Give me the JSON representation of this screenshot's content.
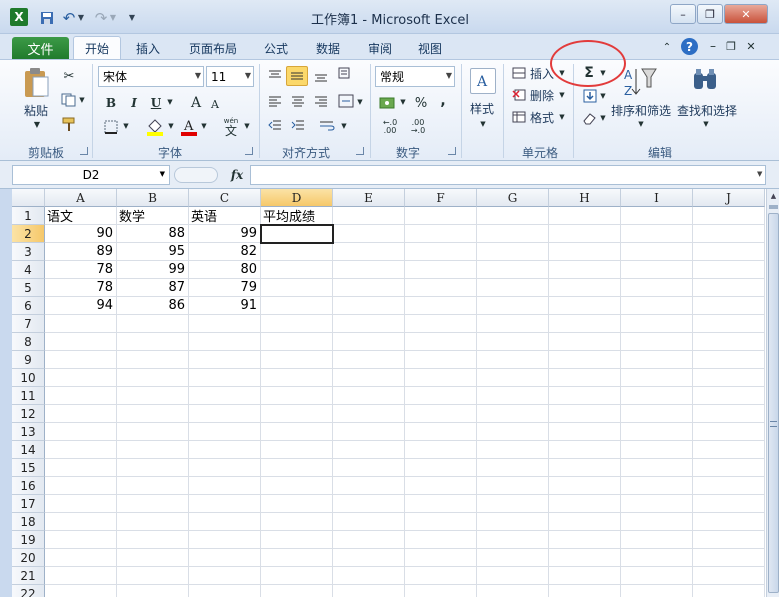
{
  "window": {
    "title": "工作簿1 - Microsoft Excel",
    "minimize": "–",
    "restore": "❐",
    "close": "✕"
  },
  "tabs": {
    "file": "文件",
    "items": [
      "开始",
      "插入",
      "页面布局",
      "公式",
      "数据",
      "审阅",
      "视图"
    ],
    "active": "开始"
  },
  "ribbon": {
    "clipboard": {
      "label": "剪贴板",
      "paste": "粘贴"
    },
    "font": {
      "label": "字体",
      "name": "宋体",
      "size": "11",
      "bold": "B",
      "italic": "I",
      "underline": "U",
      "grow": "A",
      "shrink": "A",
      "phonetic": "wén",
      "phonetic_char": "文"
    },
    "alignment": {
      "label": "对齐方式"
    },
    "number": {
      "label": "数字",
      "format": "常规",
      "percent": "%",
      "comma": ","
    },
    "styles": {
      "label": "样式"
    },
    "cells": {
      "label": "单元格",
      "insert": "插入",
      "delete": "删除",
      "format": "格式"
    },
    "editing": {
      "label": "编辑",
      "autosum": "Σ",
      "sort": "排序和筛选",
      "find": "查找和选择"
    }
  },
  "formula_bar": {
    "name_box": "D2",
    "fx": "fx",
    "content": ""
  },
  "sheet": {
    "columns": [
      "A",
      "B",
      "C",
      "D",
      "E",
      "F",
      "G",
      "H",
      "I",
      "J"
    ],
    "rows": [
      "1",
      "2",
      "3",
      "4",
      "5",
      "6",
      "7",
      "8",
      "9",
      "10",
      "11",
      "12",
      "13",
      "14",
      "15",
      "16",
      "17",
      "18",
      "19",
      "20",
      "21",
      "22"
    ],
    "headers": [
      "语文",
      "数学",
      "英语",
      "平均成绩"
    ],
    "data": [
      [
        "90",
        "88",
        "99"
      ],
      [
        "89",
        "95",
        "82"
      ],
      [
        "78",
        "99",
        "80"
      ],
      [
        "78",
        "87",
        "79"
      ],
      [
        "94",
        "86",
        "91"
      ]
    ]
  }
}
